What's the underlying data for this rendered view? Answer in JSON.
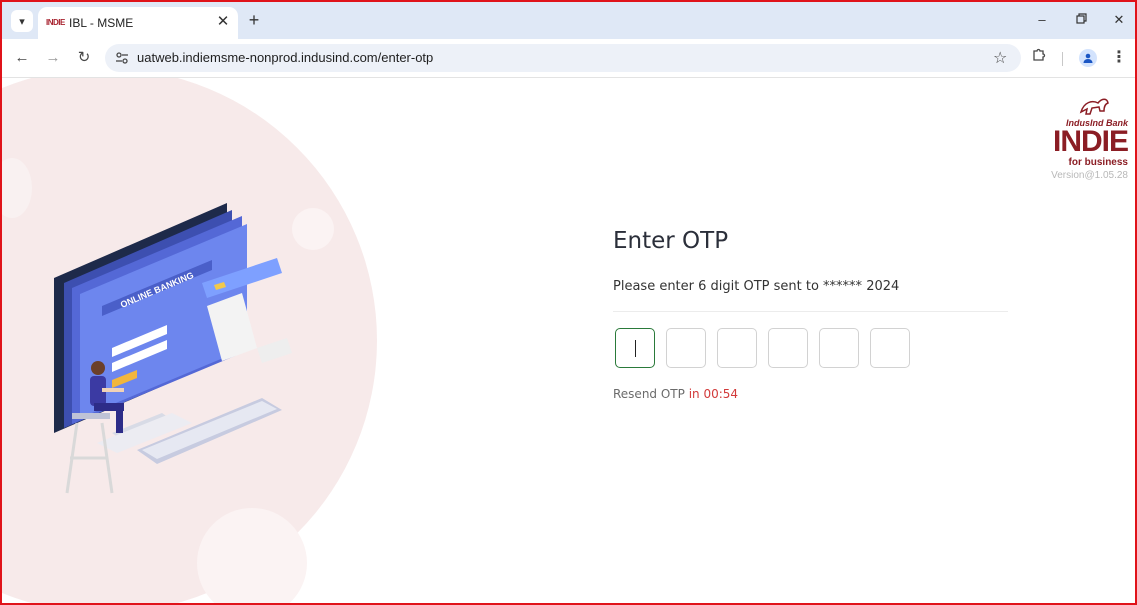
{
  "browser": {
    "tab_title": "IBL - MSME",
    "tab_favicon_text": "INDIE",
    "url": "uatweb.indiemsme-nonprod.indusind.com/enter-otp",
    "icons": {
      "tab_search": "chevron-down-icon",
      "close": "close-icon",
      "new_tab": "plus-icon",
      "back": "back-arrow-icon",
      "forward": "forward-arrow-icon",
      "reload": "reload-icon",
      "site_info": "tune-icon",
      "bookmark": "star-icon",
      "extensions": "puzzle-icon",
      "profile": "profile-icon",
      "menu": "kebab-menu-icon",
      "minimize": "minimize-icon",
      "restore": "restore-icon",
      "window_close": "window-close-icon"
    }
  },
  "logo": {
    "brand": "IndusInd Bank",
    "name": "INDIE",
    "tagline": "for business",
    "version": "Version@1.05.28",
    "color": "#8b1d24"
  },
  "illustration": {
    "screen_text": "ONLINE BANKING"
  },
  "otp": {
    "title": "Enter OTP",
    "subtitle": "Please enter 6 digit OTP sent to ****** 2024",
    "boxes": [
      "",
      "",
      "",
      "",
      "",
      ""
    ],
    "resend_label": "Resend OTP",
    "resend_timer": "in 00:54",
    "active_border_color": "#2a7a3a",
    "timer_color": "#d23a3a"
  }
}
